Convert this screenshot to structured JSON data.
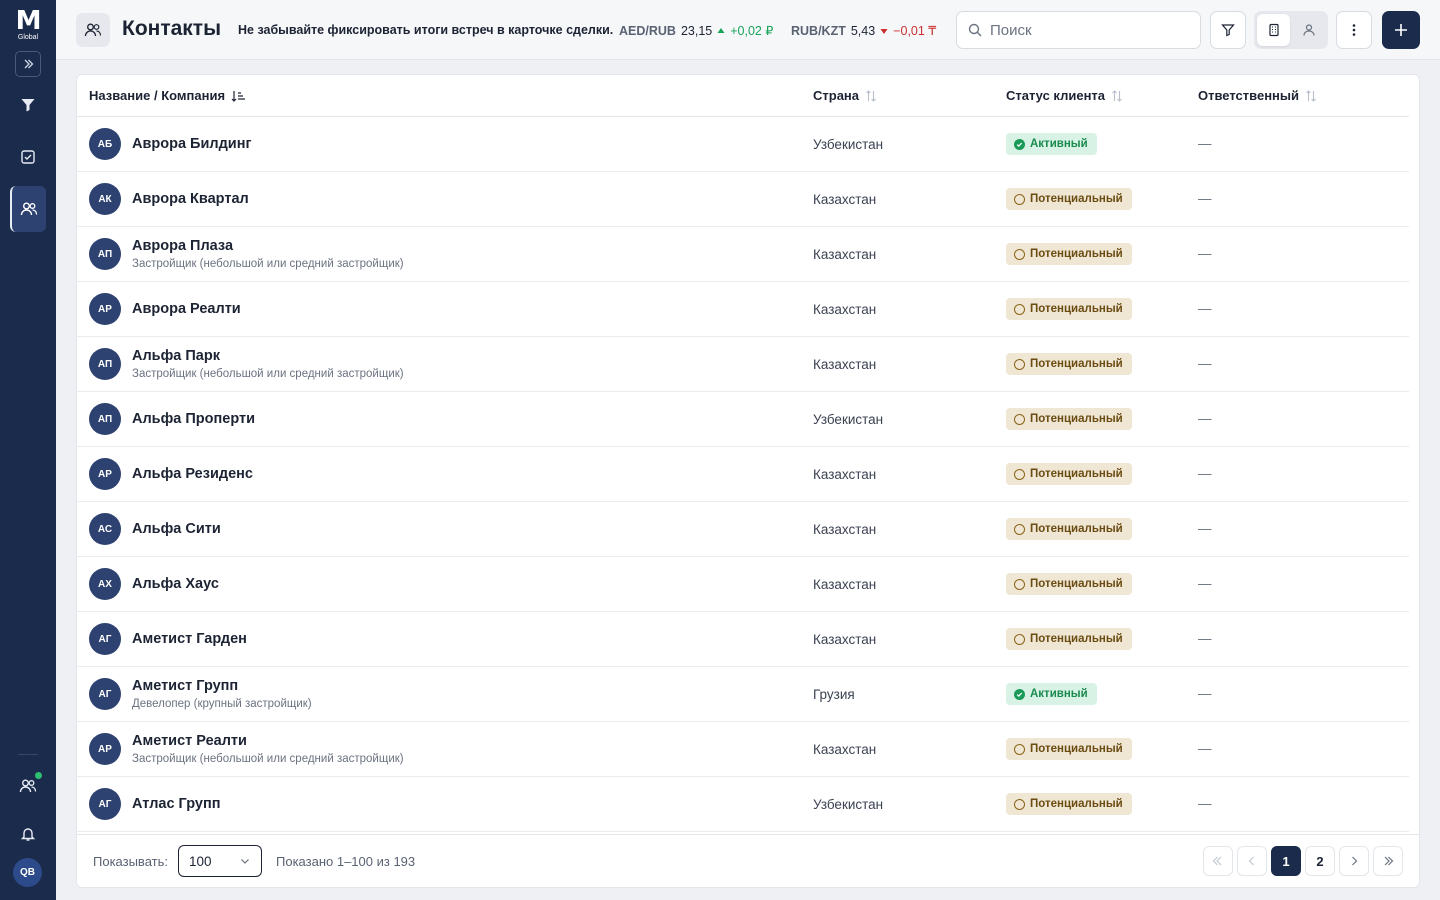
{
  "sidebar": {
    "logo_letter": "M",
    "logo_sub": "Global",
    "user_initials": "QB",
    "items": [
      {
        "icon": "funnel-icon"
      },
      {
        "icon": "task-check-icon"
      },
      {
        "icon": "contacts-icon",
        "active": true
      }
    ],
    "bottom": [
      {
        "icon": "team-icon",
        "online": true
      },
      {
        "icon": "bell-icon"
      }
    ]
  },
  "header": {
    "title": "Контакты",
    "notice": "Не забывайте фиксировать итоги встреч в карточке сделки.",
    "rates": [
      {
        "pair": "AED/RUB",
        "value": "23,15",
        "change": "+0,02 ₽",
        "direction": "up"
      },
      {
        "pair": "RUB/KZT",
        "value": "5,43",
        "change": "−0,01 ₸",
        "direction": "down"
      }
    ],
    "search_placeholder": "Поиск",
    "accent_color": "#1b2b4c"
  },
  "table": {
    "columns": {
      "name": "Название / Компания",
      "country": "Страна",
      "status": "Статус клиента",
      "owner": "Ответственный"
    },
    "rows": [
      {
        "initials": "АБ",
        "name": "Аврора Билдинг",
        "sub": "",
        "country": "Узбекистан",
        "status": "Активный",
        "status_type": "active",
        "owner": "—"
      },
      {
        "initials": "АК",
        "name": "Аврора Квартал",
        "sub": "",
        "country": "Казахстан",
        "status": "Потенциальный",
        "status_type": "potential",
        "owner": "—"
      },
      {
        "initials": "АП",
        "name": "Аврора Плаза",
        "sub": "Застройщик (небольшой или средний застройщик)",
        "country": "Казахстан",
        "status": "Потенциальный",
        "status_type": "potential",
        "owner": "—"
      },
      {
        "initials": "АР",
        "name": "Аврора Реалти",
        "sub": "",
        "country": "Казахстан",
        "status": "Потенциальный",
        "status_type": "potential",
        "owner": "—"
      },
      {
        "initials": "АП",
        "name": "Альфа Парк",
        "sub": "Застройщик (небольшой или средний застройщик)",
        "country": "Казахстан",
        "status": "Потенциальный",
        "status_type": "potential",
        "owner": "—"
      },
      {
        "initials": "АП",
        "name": "Альфа Проперти",
        "sub": "",
        "country": "Узбекистан",
        "status": "Потенциальный",
        "status_type": "potential",
        "owner": "—"
      },
      {
        "initials": "АР",
        "name": "Альфа Резиденс",
        "sub": "",
        "country": "Казахстан",
        "status": "Потенциальный",
        "status_type": "potential",
        "owner": "—"
      },
      {
        "initials": "АС",
        "name": "Альфа Сити",
        "sub": "",
        "country": "Казахстан",
        "status": "Потенциальный",
        "status_type": "potential",
        "owner": "—"
      },
      {
        "initials": "АХ",
        "name": "Альфа Хаус",
        "sub": "",
        "country": "Казахстан",
        "status": "Потенциальный",
        "status_type": "potential",
        "owner": "—"
      },
      {
        "initials": "АГ",
        "name": "Аметист Гарден",
        "sub": "",
        "country": "Казахстан",
        "status": "Потенциальный",
        "status_type": "potential",
        "owner": "—"
      },
      {
        "initials": "АГ",
        "name": "Аметист Групп",
        "sub": "Девелопер (крупный застройщик)",
        "country": "Грузия",
        "status": "Активный",
        "status_type": "active",
        "owner": "—"
      },
      {
        "initials": "АР",
        "name": "Аметист Реалти",
        "sub": "Застройщик (небольшой или средний застройщик)",
        "country": "Казахстан",
        "status": "Потенциальный",
        "status_type": "potential",
        "owner": "—"
      },
      {
        "initials": "АГ",
        "name": "Атлас Групп",
        "sub": "",
        "country": "Узбекистан",
        "status": "Потенциальный",
        "status_type": "potential",
        "owner": "—"
      }
    ]
  },
  "footer": {
    "show_label": "Показывать:",
    "per_page": "100",
    "shown_text": "Показано 1–100 из 193",
    "pages": [
      "1",
      "2"
    ],
    "current_page": "1"
  }
}
